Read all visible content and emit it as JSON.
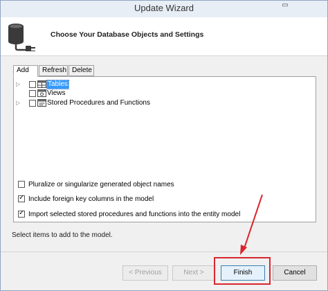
{
  "window": {
    "title": "Update Wizard"
  },
  "header": {
    "title": "Choose Your Database Objects and Settings"
  },
  "tabs": [
    {
      "label": "Add",
      "active": true
    },
    {
      "label": "Refresh",
      "active": false
    },
    {
      "label": "Delete",
      "active": false
    }
  ],
  "tree": {
    "items": [
      {
        "label": "Tables",
        "expandable": true,
        "selected": true
      },
      {
        "label": "Views",
        "expandable": false,
        "selected": false
      },
      {
        "label": "Stored Procedures and Functions",
        "expandable": true,
        "selected": false
      }
    ]
  },
  "options": {
    "pluralize": {
      "label": "Pluralize or singularize generated object names",
      "checked": false
    },
    "foreign_keys": {
      "label": "Include foreign key columns in the model",
      "checked": true
    },
    "import_procs": {
      "label": "Import selected stored procedures and functions into the entity model",
      "checked": true
    }
  },
  "status": {
    "text": "Select items to add to the model."
  },
  "buttons": {
    "previous": "< Previous",
    "next": "Next >",
    "finish": "Finish",
    "cancel": "Cancel"
  },
  "colors": {
    "annotation": "#d9262e",
    "selection": "#3399ff"
  }
}
